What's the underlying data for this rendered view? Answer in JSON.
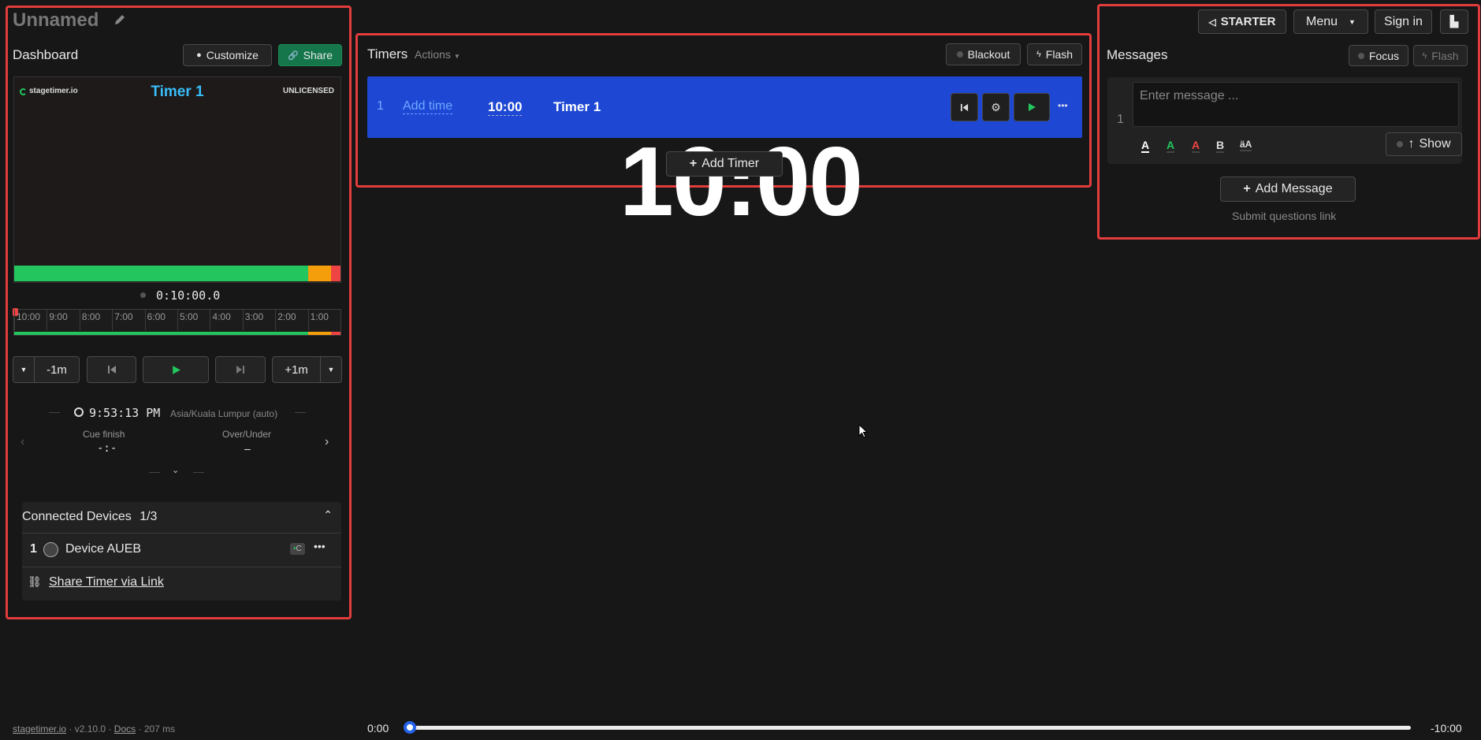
{
  "project": {
    "title": "Unnamed"
  },
  "dashboard": {
    "heading": "Dashboard",
    "customize_label": "Customize",
    "share_label": "Share",
    "preview": {
      "logo_text": "stagetimer.io",
      "timer_name": "Timer 1",
      "license": "UNLICENSED",
      "time_display": "10:00"
    },
    "progress": {
      "green": 0.9,
      "orange": 0.07,
      "red": 0.03
    },
    "elapsed": "0:10:00.0",
    "timeline_ticks": [
      "10:00",
      "9:00",
      "8:00",
      "7:00",
      "6:00",
      "5:00",
      "4:00",
      "3:00",
      "2:00",
      "1:00"
    ],
    "controls": {
      "minus": "-1m",
      "plus": "+1m"
    },
    "clock": {
      "time": "9:53:13 PM",
      "timezone": "Asia/Kuala Lumpur (auto)"
    },
    "cue_finish": {
      "label": "Cue finish",
      "value": "-:-"
    },
    "over_under": {
      "label": "Over/Under",
      "value": "–"
    },
    "devices": {
      "title": "Connected Devices",
      "count": "1/3",
      "rows": [
        {
          "index": "1",
          "name": "Device AUEB",
          "badge": "C"
        }
      ],
      "share_link": "Share Timer via Link"
    }
  },
  "timers": {
    "heading": "Timers",
    "actions_label": "Actions",
    "blackout_label": "Blackout",
    "flash_label": "Flash",
    "rows": [
      {
        "index": "1",
        "add_time": "Add time",
        "duration": "10:00",
        "name": "Timer 1"
      }
    ],
    "add_timer_label": "Add Timer"
  },
  "messages": {
    "heading": "Messages",
    "focus_label": "Focus",
    "flash_label": "Flash",
    "rows": [
      {
        "index": "1",
        "placeholder": "Enter message ..."
      }
    ],
    "show_label": "Show",
    "add_message_label": "Add Message",
    "submit_link": "Submit questions link"
  },
  "topbar": {
    "plan_label": "STARTER",
    "menu_label": "Menu",
    "signin_label": "Sign in"
  },
  "footer": {
    "site": "stagetimer.io",
    "version": "v2.10.0",
    "docs": "Docs",
    "latency": "207 ms"
  },
  "playback": {
    "start": "0:00",
    "end": "-10:00",
    "position": 0
  },
  "colors": {
    "accent_blue": "#1e48d4",
    "highlight_red": "#e23c3c",
    "progress_green": "#22c55e",
    "progress_orange": "#f59e0b",
    "progress_red": "#ef4444",
    "share_green": "#14764a",
    "timer_name_blue": "#38bdf8"
  }
}
